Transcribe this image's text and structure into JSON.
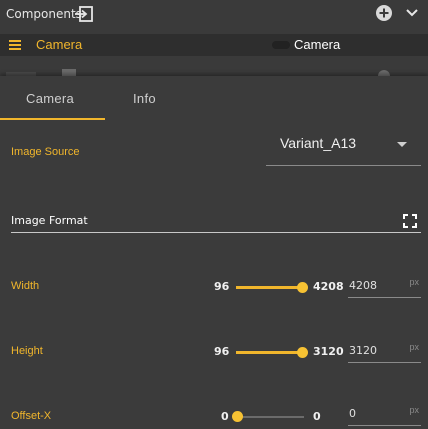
{
  "header": {
    "title": "Components",
    "icons": [
      "export-icon",
      "add-circle-icon",
      "chevron-down-icon"
    ]
  },
  "camera_row": {
    "label": "Camera",
    "right_label": "Camera"
  },
  "tabs": [
    {
      "label": "Camera"
    },
    {
      "label": "Info"
    }
  ],
  "active_tab": "Camera",
  "image_source": {
    "label": "Image Source",
    "value": "Variant_A13"
  },
  "image_format": {
    "label": "Image Format"
  },
  "sliders": [
    {
      "label": "Width",
      "min": "96",
      "max": "4208",
      "value": "4208",
      "unit": "px",
      "fraction": 1.0
    },
    {
      "label": "Height",
      "min": "96",
      "max": "3120",
      "value": "3120",
      "unit": "px",
      "fraction": 1.0
    },
    {
      "label": "Offset-X",
      "min": "0",
      "max": "0",
      "value": "0",
      "unit": "px",
      "fraction": 0.0
    }
  ],
  "colors": {
    "accent": "#f1b62c",
    "background": "#3a3a3a",
    "bar": "#2e2e2e"
  }
}
